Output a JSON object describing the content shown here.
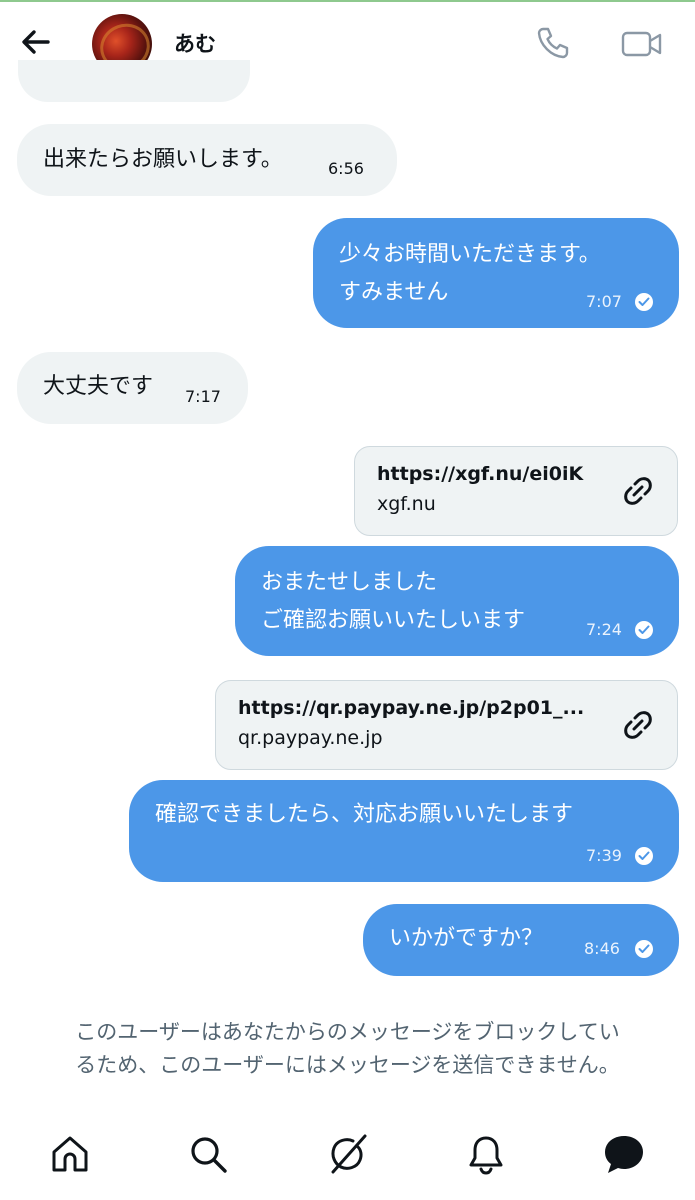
{
  "header": {
    "contact_name": "あむ",
    "icons": [
      "back-arrow-icon",
      "phone-icon",
      "video-camera-icon"
    ]
  },
  "messages": [
    {
      "direction": "in",
      "text": "出来たらお願いします。",
      "time": "6:56"
    },
    {
      "direction": "out",
      "lines": [
        "少々お時間いただきます。",
        "すみません"
      ],
      "time": "7:07",
      "read": true
    },
    {
      "direction": "in",
      "text": "大丈夫です",
      "time": "7:17"
    },
    {
      "direction": "out",
      "type": "link-card",
      "title": "https://xgf.nu/ei0iK",
      "domain": "xgf.nu"
    },
    {
      "direction": "out",
      "lines": [
        "おまたせしました",
        "ご確認お願いいたしいます"
      ],
      "time": "7:24",
      "read": true
    },
    {
      "direction": "out",
      "type": "link-card",
      "title": "https://qr.paypay.ne.jp/p2p01_...",
      "domain": "qr.paypay.ne.jp"
    },
    {
      "direction": "out",
      "text": "確認できましたら、対応お願いいたします",
      "time": "7:39",
      "read": true
    },
    {
      "direction": "out",
      "text": "いかがですか？",
      "time": "8:46",
      "read": true
    }
  ],
  "blocked_notice": {
    "line1": "このユーザーはあなたからのメッセージをブロックしてい",
    "line2": "るため、このユーザーにはメッセージを送信できません。"
  },
  "bottom_nav": {
    "items": [
      "home-icon",
      "search-icon",
      "grok-icon",
      "notifications-bell-icon",
      "messages-icon"
    ],
    "active": "messages-icon"
  },
  "colors": {
    "outgoing_bubble": "#4c97e8",
    "incoming_bubble": "#eff3f4",
    "secondary_text": "#536471"
  }
}
